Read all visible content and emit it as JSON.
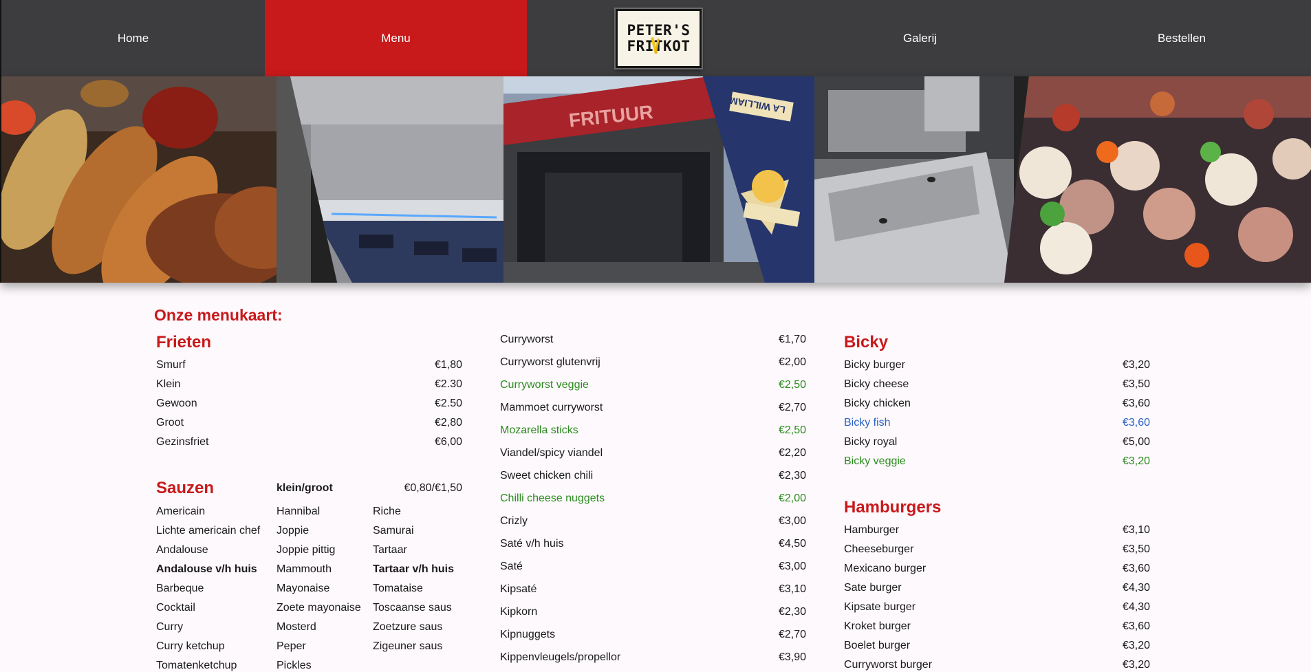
{
  "nav": {
    "home": "Home",
    "menu": "Menu",
    "galerij": "Galerij",
    "bestellen": "Bestellen",
    "logo_line1": "PETER'S",
    "logo_line2": "FRITKOT"
  },
  "banner": {
    "frituur_sign": "FRITUUR",
    "flag_text": "LA WILLIAM"
  },
  "menu_title": "Onze menukaart:",
  "frieten": {
    "title": "Frieten",
    "items": [
      {
        "name": "Smurf",
        "price": "€1,80"
      },
      {
        "name": "Klein",
        "price": "€2.30"
      },
      {
        "name": "Gewoon",
        "price": "€2.50"
      },
      {
        "name": "Groot",
        "price": "€2,80"
      },
      {
        "name": "Gezinsfriet",
        "price": "€6,00"
      }
    ]
  },
  "sauzen": {
    "title": "Sauzen",
    "size_label": "klein/groot",
    "size_price": "€0,80/€1,50",
    "col1": [
      "Americain",
      "Lichte americain chef",
      "Andalouse",
      "Andalouse v/h huis",
      "Barbeque",
      "Cocktail",
      "Curry",
      "Curry ketchup",
      "Tomatenketchup"
    ],
    "col2": [
      "Hannibal",
      "Joppie",
      "Joppie pittig",
      "Mammouth",
      "Mayonaise",
      "Zoete mayonaise",
      "Mosterd",
      "Peper",
      "Pickles"
    ],
    "col3": [
      "Riche",
      "Samurai",
      "Tartaar",
      "Tartaar v/h huis",
      "Tomataise",
      "Toscaanse saus",
      "Zoetzure saus",
      "Zigeuner saus"
    ]
  },
  "snacks": {
    "items": [
      {
        "name": "Curryworst",
        "price": "€1,70",
        "style": ""
      },
      {
        "name": "Curryworst glutenvrij",
        "price": "€2,00",
        "style": ""
      },
      {
        "name": "Curryworst veggie",
        "price": "€2,50",
        "style": "green"
      },
      {
        "name": "Mammoet curryworst",
        "price": "€2,70",
        "style": ""
      },
      {
        "name": "Mozarella sticks",
        "price": "€2,50",
        "style": "green"
      },
      {
        "name": "Viandel/spicy viandel",
        "price": "€2,20",
        "style": ""
      },
      {
        "name": "Sweet chicken chili",
        "price": "€2,30",
        "style": ""
      },
      {
        "name": "Chilli cheese nuggets",
        "price": "€2,00",
        "style": "green"
      },
      {
        "name": "Crizly",
        "price": "€3,00",
        "style": ""
      },
      {
        "name": "Saté v/h huis",
        "price": "€4,50",
        "style": ""
      },
      {
        "name": "Saté",
        "price": "€3,00",
        "style": ""
      },
      {
        "name": "Kipsaté",
        "price": "€3,10",
        "style": ""
      },
      {
        "name": "Kipkorn",
        "price": "€2,30",
        "style": ""
      },
      {
        "name": "Kipnuggets",
        "price": "€2,70",
        "style": ""
      },
      {
        "name": "Kippenvleugels/propellor",
        "price": "€3,90",
        "style": ""
      }
    ]
  },
  "bicky": {
    "title": "Bicky",
    "items": [
      {
        "name": "Bicky burger",
        "price": "€3,20",
        "style": ""
      },
      {
        "name": "Bicky cheese",
        "price": "€3,50",
        "style": ""
      },
      {
        "name": "Bicky chicken",
        "price": "€3,60",
        "style": ""
      },
      {
        "name": "Bicky fish",
        "price": "€3,60",
        "style": "blue"
      },
      {
        "name": "Bicky royal",
        "price": "€5,00",
        "style": ""
      },
      {
        "name": "Bicky veggie",
        "price": "€3,20",
        "style": "green"
      }
    ]
  },
  "hamburgers": {
    "title": "Hamburgers",
    "items": [
      {
        "name": "Hamburger",
        "price": "€3,10"
      },
      {
        "name": "Cheeseburger",
        "price": "€3,50"
      },
      {
        "name": "Mexicano burger",
        "price": "€3,60"
      },
      {
        "name": "Sate burger",
        "price": "€4,30"
      },
      {
        "name": "Kipsate burger",
        "price": "€4,30"
      },
      {
        "name": "Kroket burger",
        "price": "€3,60"
      },
      {
        "name": "Boelet burger",
        "price": "€3,20"
      },
      {
        "name": "Curryworst burger",
        "price": "€3,20"
      }
    ]
  }
}
